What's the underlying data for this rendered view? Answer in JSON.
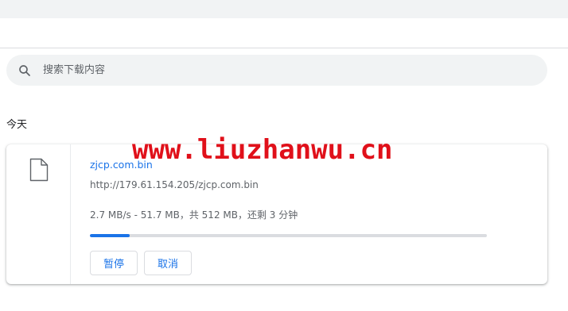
{
  "search": {
    "placeholder": "搜索下载内容"
  },
  "section": {
    "date_label": "今天"
  },
  "download": {
    "file_name": "zjcp.com.bin",
    "url": "http://179.61.154.205/zjcp.com.bin",
    "status": "2.7 MB/s - 51.7 MB，共 512 MB，还剩 3 分钟",
    "progress_fraction": 0.101,
    "pause_label": "暂停",
    "cancel_label": "取消"
  },
  "watermark": {
    "text": "www.liuzhanwu.cn"
  },
  "colors": {
    "accent": "#1a73e8",
    "watermark": "#e0101a",
    "search_bg": "#f1f3f4"
  },
  "icons": {
    "search": "search-icon",
    "file": "file-icon"
  }
}
